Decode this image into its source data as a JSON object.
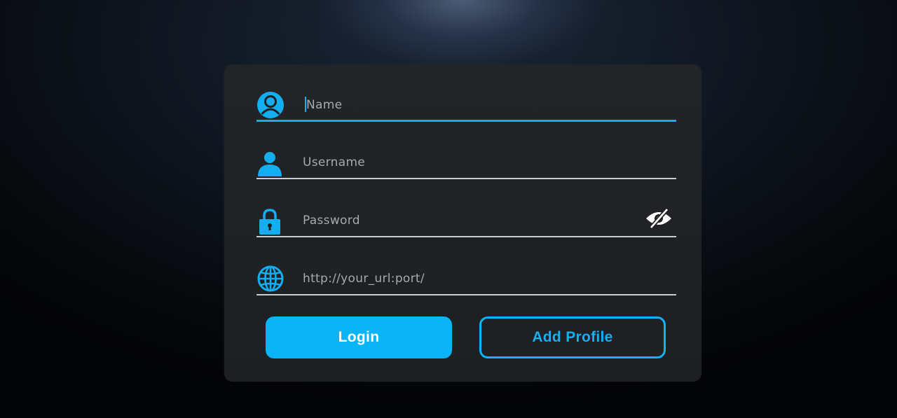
{
  "form": {
    "name_field": {
      "placeholder": "Name",
      "icon": "user-circle-icon"
    },
    "username_field": {
      "placeholder": "Username",
      "icon": "user-icon"
    },
    "password_field": {
      "placeholder": "Password",
      "icon": "lock-icon",
      "toggle_icon": "eye-off-icon"
    },
    "url_field": {
      "placeholder": "http://your_url:port/",
      "icon": "globe-icon"
    }
  },
  "buttons": {
    "login_label": "Login",
    "add_profile_label": "Add Profile"
  },
  "colors": {
    "accent": "#0bb4f6",
    "card": "#1f2124",
    "underline": "#c9ccd0"
  }
}
